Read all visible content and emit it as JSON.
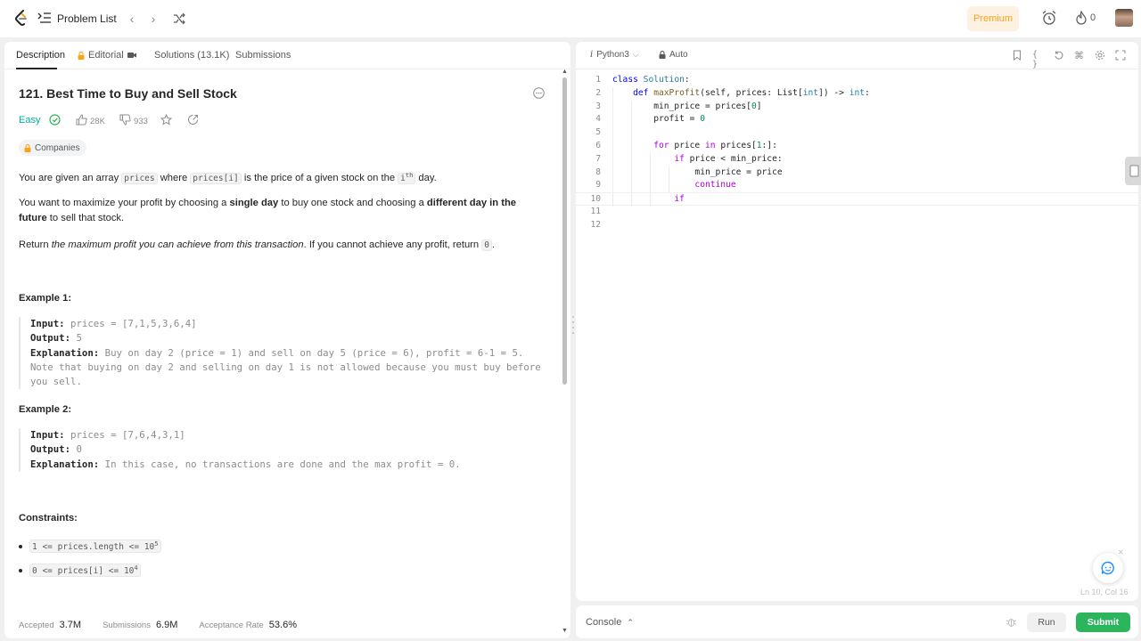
{
  "nav": {
    "problem_list": "Problem List",
    "premium": "Premium",
    "streak": "0"
  },
  "tabs": {
    "description": "Description",
    "editorial": "Editorial",
    "solutions": "Solutions (13.1K)",
    "submissions": "Submissions"
  },
  "problem": {
    "title": "121. Best Time to Buy and Sell Stock",
    "difficulty": "Easy",
    "likes": "28K",
    "dislikes": "933",
    "companies": "Companies",
    "p1_a": "You are given an array ",
    "p1_code1": "prices",
    "p1_b": " where ",
    "p1_code2": "prices[i]",
    "p1_c": " is the price of a given stock on the ",
    "p1_code3": "i",
    "p1_sup": "th",
    "p1_d": " day.",
    "p2_a": "You want to maximize your profit by choosing a ",
    "p2_b1": "single day",
    "p2_b": " to buy one stock and choosing a ",
    "p2_b2": "different day in the future",
    "p2_c": " to sell that stock.",
    "p3_a": "Return ",
    "p3_em": "the maximum profit you can achieve from this transaction",
    "p3_b": ". If you cannot achieve any profit, return ",
    "p3_code": "0",
    "p3_c": "."
  },
  "examples": [
    {
      "title": "Example 1:",
      "input_label": "Input:",
      "input": "prices = [7,1,5,3,6,4]",
      "output_label": "Output:",
      "output": "5",
      "explanation_label": "Explanation:",
      "explanation": "Buy on day 2 (price = 1) and sell on day 5 (price = 6), profit = 6-1 = 5.",
      "note": "Note that buying on day 2 and selling on day 1 is not allowed because you must buy before you sell."
    },
    {
      "title": "Example 2:",
      "input_label": "Input:",
      "input": "prices = [7,6,4,3,1]",
      "output_label": "Output:",
      "output": "0",
      "explanation_label": "Explanation:",
      "explanation": "In this case, no transactions are done and the max profit = 0."
    }
  ],
  "constraints": {
    "title": "Constraints:",
    "c1": "1 <= prices.length <= 10",
    "c1_sup": "5",
    "c2": "0 <= prices[i] <= 10",
    "c2_sup": "4"
  },
  "stats": {
    "accepted_label": "Accepted",
    "accepted": "3.7M",
    "submissions_label": "Submissions",
    "submissions": "6.9M",
    "rate_label": "Acceptance Rate",
    "rate": "53.6%"
  },
  "editor": {
    "language": "Python3",
    "mode": "Auto",
    "cursor": "Ln 10, Col 16",
    "line_numbers": [
      "1",
      "2",
      "3",
      "4",
      "5",
      "6",
      "7",
      "8",
      "9",
      "10",
      "11",
      "12"
    ]
  },
  "console": {
    "label": "Console",
    "run": "Run",
    "submit": "Submit"
  },
  "colors": {
    "easy": "#00af9b",
    "premium": "#ffa116",
    "submit": "#2db55d",
    "keyword": "#af00db",
    "builtin": "#0000ff"
  }
}
